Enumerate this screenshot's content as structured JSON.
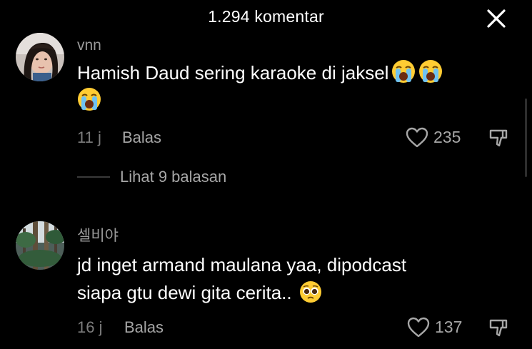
{
  "header": {
    "title": "1.294 komentar"
  },
  "comments": [
    {
      "username": "vnn",
      "avatar": "woman-portrait",
      "text": "Hamish Daud sering karaoke di jaksel",
      "emojis": [
        "loudly-crying-face",
        "loudly-crying-face",
        "loudly-crying-face"
      ],
      "time": "11 j",
      "reply_label": "Balas",
      "likes": "235",
      "view_replies_label": "Lihat 9 balasan"
    },
    {
      "username": "셀비야",
      "avatar": "forest-trees",
      "text_line1": "jd inget armand maulana yaa, dipodcast",
      "text_line2": "siapa gtu dewi gita cerita..",
      "emojis": [
        "pleading-face"
      ],
      "time": "16 j",
      "reply_label": "Balas",
      "likes": "137"
    }
  ],
  "colors": {
    "background": "#000000",
    "text_primary": "#ffffff",
    "text_secondary": "#a6a6a6",
    "text_muted": "#7d7d7d"
  }
}
